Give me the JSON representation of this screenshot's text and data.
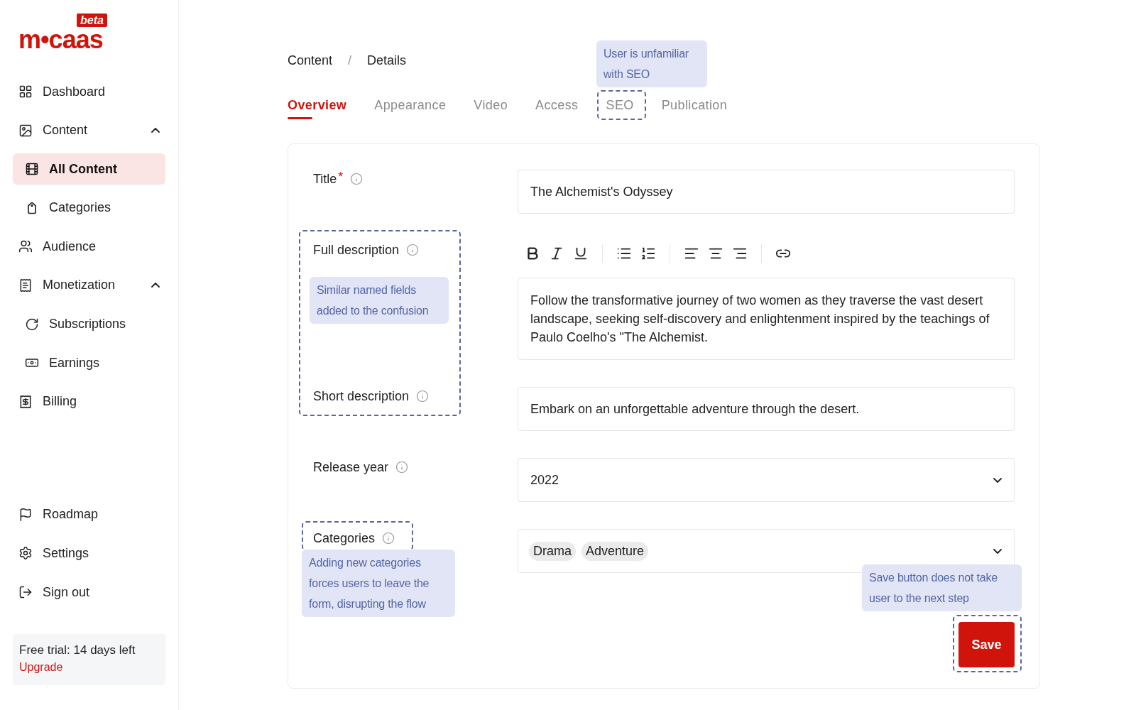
{
  "logo": {
    "text": "m•caas",
    "badge": "beta"
  },
  "sidebar": {
    "items": [
      {
        "label": "Dashboard",
        "selected": false
      },
      {
        "label": "Content",
        "selected": false,
        "expanded": true,
        "children": [
          {
            "label": "All Content",
            "selected": true
          },
          {
            "label": "Categories",
            "selected": false
          }
        ]
      },
      {
        "label": "Audience",
        "selected": false
      },
      {
        "label": "Monetization",
        "selected": false,
        "expanded": true,
        "children": [
          {
            "label": "Subscriptions",
            "selected": false
          },
          {
            "label": "Earnings",
            "selected": false
          }
        ]
      },
      {
        "label": "Billing",
        "selected": false
      }
    ],
    "bottom_items": [
      {
        "label": "Roadmap",
        "selected": false
      },
      {
        "label": "Settings",
        "selected": false
      },
      {
        "label": "Sign out",
        "selected": false
      }
    ],
    "trial": {
      "text": "Free trial: 14 days left",
      "link": "Upgrade"
    }
  },
  "breadcrumb": {
    "items": [
      "Content",
      "Details"
    ],
    "separator": "/"
  },
  "tabs": [
    {
      "label": "Overview",
      "selected": true
    },
    {
      "label": "Appearance",
      "selected": false
    },
    {
      "label": "Video",
      "selected": false
    },
    {
      "label": "Access",
      "selected": false
    },
    {
      "label": "SEO",
      "selected": false
    },
    {
      "label": "Publication",
      "selected": false
    }
  ],
  "form": {
    "fields": [
      {
        "kind": "text",
        "label": "Title",
        "required": true,
        "required_mark": "*",
        "value": "The Alchemist's Odyssey"
      },
      {
        "kind": "richtext",
        "label": "Full description",
        "value": "Follow the transformative journey of two women as they traverse the vast desert landscape, seeking self-discovery and enlightenment inspired by the teachings of Paulo Coelho's \"The Alchemist."
      },
      {
        "kind": "text",
        "label": "Short description",
        "value": "Embark on an unforgettable adventure through the desert."
      },
      {
        "kind": "select",
        "label": "Release year",
        "value": "2022"
      },
      {
        "kind": "tags",
        "label": "Categories",
        "tags": [
          "Drama",
          "Adventure"
        ]
      }
    ],
    "save_button": "Save"
  },
  "annotations": [
    {
      "text": "User is unfamiliar with SEO"
    },
    {
      "text": "Similar named fields added to the confusion"
    },
    {
      "text": "Adding new categories forces users to leave the form, disrupting the flow"
    },
    {
      "text": "Save button does not take user to the next step"
    }
  ]
}
